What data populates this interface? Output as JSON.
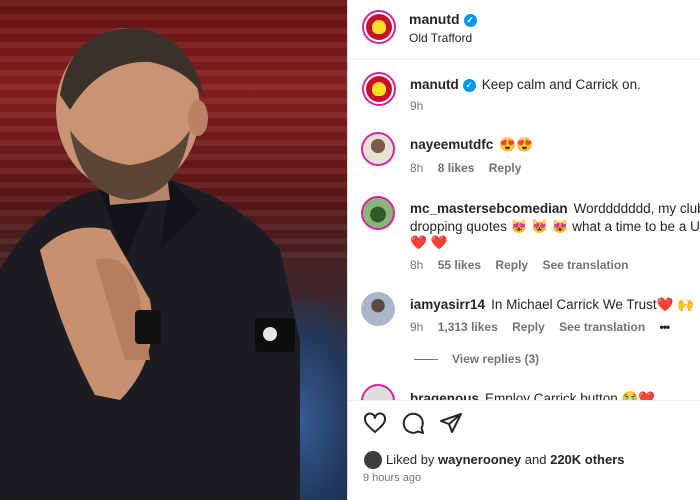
{
  "post": {
    "handle": "manutd",
    "location": "Old Trafford"
  },
  "caption": {
    "handle": "manutd",
    "text": "Keep calm and Carrick on.",
    "time": "9h"
  },
  "comments": [
    {
      "handle": "nayeemutdfc",
      "text": "😍😍",
      "time": "8h",
      "likes": "8 likes",
      "reply": "Reply"
    },
    {
      "handle": "mc_mastersebcomedian",
      "text_line1": "Worddddddd, my club is",
      "text_line2": "dropping quotes 😻 😻 😻  what a time to be a Un",
      "text_line3": "❤️ ❤️",
      "time": "8h",
      "likes": "55 likes",
      "reply": "Reply",
      "translate": "See translation"
    },
    {
      "handle": "iamyasirr14",
      "text": "In Michael Carrick We Trust❤️ 🙌",
      "time": "9h",
      "likes": "1,313 likes",
      "reply": "Reply",
      "translate": "See translation",
      "more": "•••"
    }
  ],
  "view_replies": "View replies (3)",
  "partial_comment": {
    "handle": "bragenous",
    "text": "Employ Carrick button 😭❤️"
  },
  "footer": {
    "liked_prefix": "Liked by",
    "liked_user": "waynerooney",
    "liked_and": "and",
    "liked_others": "220K others",
    "time_ago": "9 hours ago"
  },
  "icons": [
    "heart-icon",
    "comment-icon",
    "share-icon",
    "verified-icon",
    "more-icon"
  ],
  "colors": {
    "brand_red": "#c8102e",
    "verified_blue": "#0095f6",
    "muted": "#737373"
  }
}
